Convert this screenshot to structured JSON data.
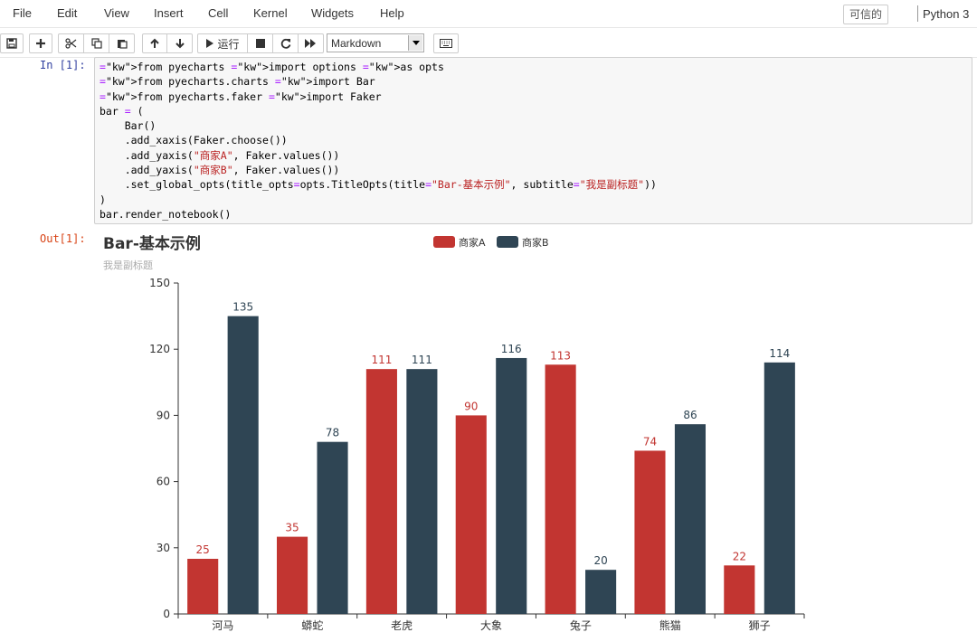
{
  "menubar": {
    "items": [
      "File",
      "Edit",
      "View",
      "Insert",
      "Cell",
      "Kernel",
      "Widgets",
      "Help"
    ],
    "trusted_label": "可信的",
    "kernel_name": "Python 3"
  },
  "toolbar": {
    "run_label": "运行",
    "cell_type": "Markdown"
  },
  "cell_in": {
    "prompt": "In [1]:",
    "code_lines": [
      "from pyecharts import options as opts",
      "from pyecharts.charts import Bar",
      "from pyecharts.faker import Faker",
      "bar = (",
      "    Bar()",
      "    .add_xaxis(Faker.choose())",
      "    .add_yaxis(\"商家A\", Faker.values())",
      "    .add_yaxis(\"商家B\", Faker.values())",
      "    .set_global_opts(title_opts=opts.TitleOpts(title=\"Bar-基本示例\", subtitle=\"我是副标题\"))",
      ")",
      "bar.render_notebook()"
    ]
  },
  "cell_out": {
    "prompt": "Out[1]:"
  },
  "chart_data": {
    "type": "bar",
    "title": "Bar-基本示例",
    "subtitle": "我是副标题",
    "categories": [
      "河马",
      "蟒蛇",
      "老虎",
      "大象",
      "兔子",
      "熊猫",
      "狮子"
    ],
    "series": [
      {
        "name": "商家A",
        "color": "#c23531",
        "values": [
          25,
          35,
          111,
          90,
          113,
          74,
          22
        ]
      },
      {
        "name": "商家B",
        "color": "#2f4554",
        "values": [
          135,
          78,
          111,
          116,
          20,
          86,
          114
        ]
      }
    ],
    "ylim": [
      0,
      150
    ],
    "yticks": [
      0,
      30,
      60,
      90,
      120,
      150
    ],
    "legend_position": "top-center",
    "grid": false
  }
}
